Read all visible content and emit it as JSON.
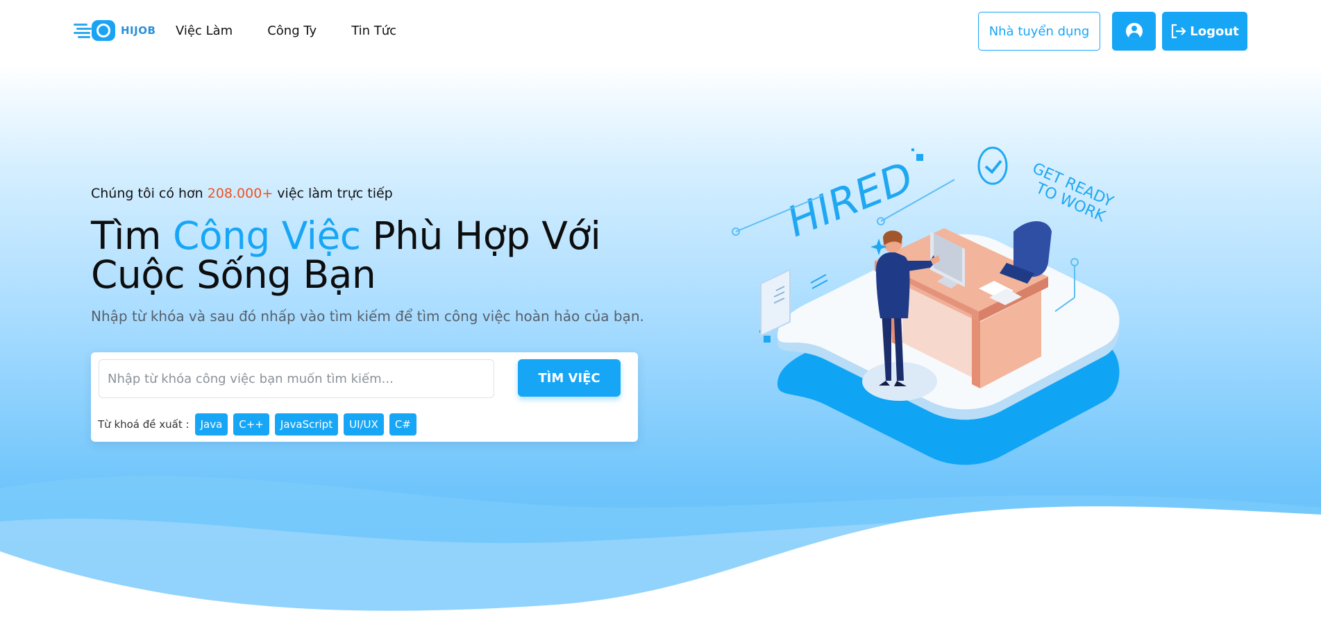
{
  "brand": {
    "name": "HIJOB"
  },
  "nav": {
    "items": [
      "Việc Làm",
      "Công Ty",
      "Tin Tức"
    ]
  },
  "header": {
    "recruiter_label": "Nhà tuyển dụng",
    "logout_label": "Logout"
  },
  "hero": {
    "subtitle_pre": "Chúng tôi có hơn ",
    "subtitle_count": "208.000+",
    "subtitle_post": " việc làm trực tiếp",
    "headline_pre": "Tìm ",
    "headline_highlight": "Công Việc",
    "headline_post": " Phù Hợp Với Cuộc Sống Bạn",
    "description": "Nhập từ khóa và sau đó nhấp vào tìm kiếm để tìm công việc hoàn hảo của bạn."
  },
  "search": {
    "placeholder": "Nhập từ khóa công việc bạn muốn tìm kiếm...",
    "button_label": "TÌM VIỆC",
    "suggest_label": "Từ khoá đề xuất :",
    "keywords": [
      "Java",
      "C++",
      "JavaScript",
      "UI/UX",
      "C#"
    ]
  },
  "illustration": {
    "hired_text": "HIRED",
    "ready_line1": "GET READY",
    "ready_line2": "TO WORK"
  },
  "colors": {
    "accent": "#17a6f6",
    "highlight": "#f0501e"
  }
}
